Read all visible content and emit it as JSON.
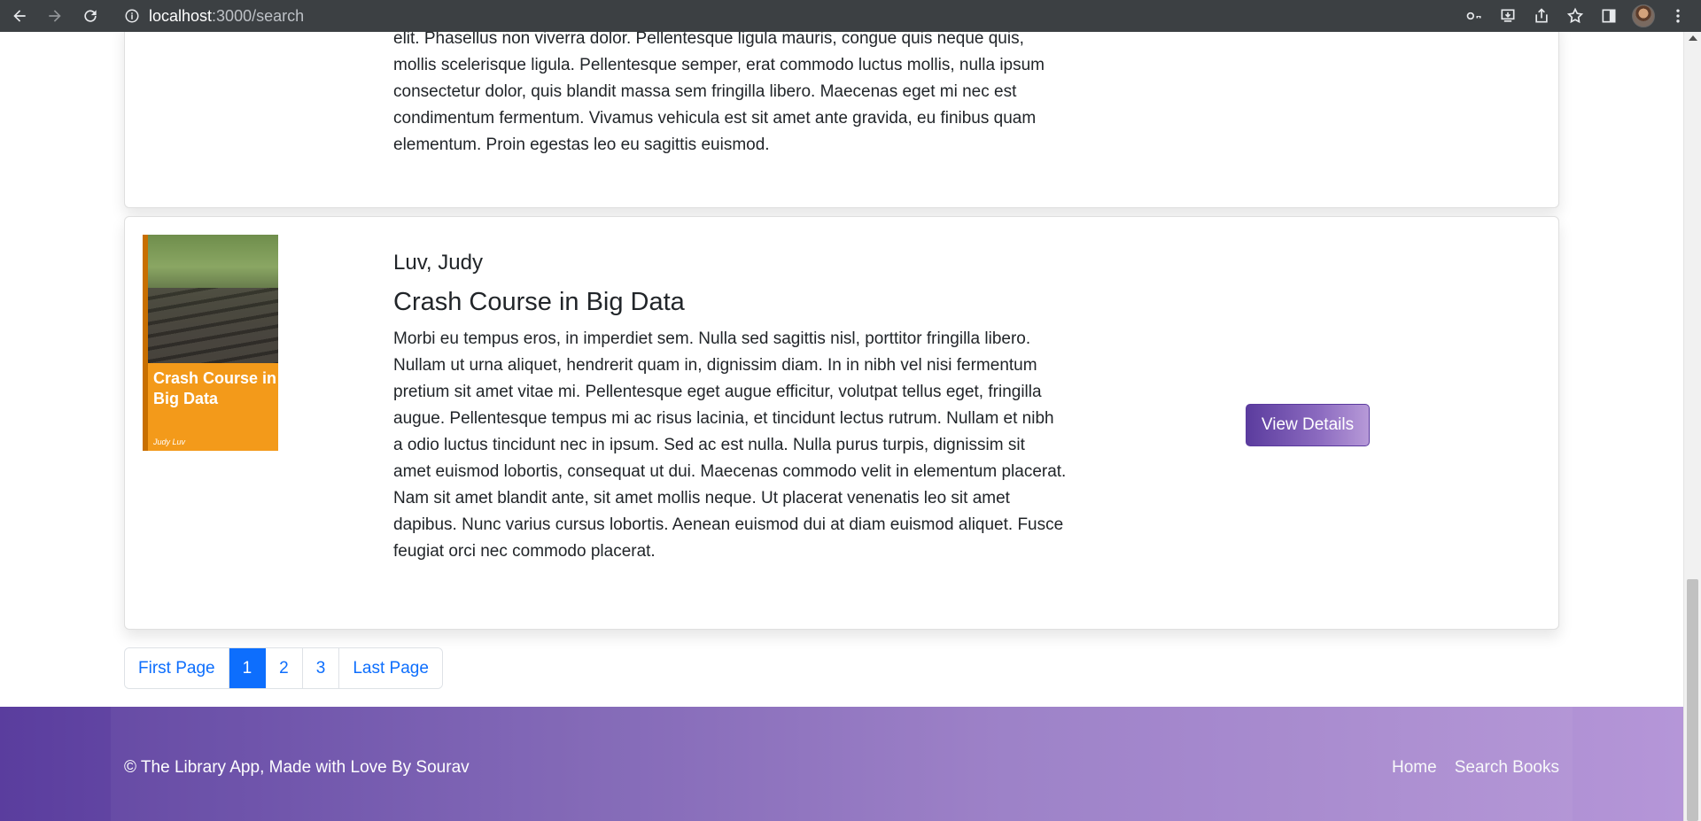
{
  "browser": {
    "url_host": "localhost",
    "url_path": ":3000/search"
  },
  "results": [
    {
      "description": "elit. Phasellus non viverra dolor. Pellentesque ligula mauris, congue quis neque quis, mollis scelerisque ligula. Pellentesque semper, erat commodo luctus mollis, nulla ipsum consectetur dolor, quis blandit massa sem fringilla libero. Maecenas eget mi nec est condimentum fermentum. Vivamus vehicula est sit amet ante gravida, eu finibus quam elementum. Proin egestas leo eu sagittis euismod."
    },
    {
      "author": "Luv, Judy",
      "title": "Crash Course in Big Data",
      "cover_title": "Crash Course in Big Data",
      "cover_author": "Judy Luv",
      "description": "Morbi eu tempus eros, in imperdiet sem. Nulla sed sagittis nisl, porttitor fringilla libero. Nullam ut urna aliquet, hendrerit quam in, dignissim diam. In in nibh vel nisi fermentum pretium sit amet vitae mi. Pellentesque eget augue efficitur, volutpat tellus eget, fringilla augue. Pellentesque tempus mi ac risus lacinia, et tincidunt lectus rutrum. Nullam et nibh a odio luctus tincidunt nec in ipsum. Sed ac est nulla. Nulla purus turpis, dignissim sit amet euismod lobortis, consequat ut dui. Maecenas commodo velit in elementum placerat. Nam sit amet blandit ante, sit amet mollis neque. Ut placerat venenatis leo sit amet dapibus. Nunc varius cursus lobortis. Aenean euismod dui at diam euismod aliquet. Fusce feugiat orci nec commodo placerat.",
      "button_label": "View Details"
    }
  ],
  "pagination": {
    "first": "First Page",
    "pages": [
      "1",
      "2",
      "3"
    ],
    "active": "1",
    "last": "Last Page"
  },
  "footer": {
    "copyright": "© The Library App, Made with Love By Sourav",
    "links": [
      "Home",
      "Search Books"
    ]
  },
  "colors": {
    "primary": "#0d6efd",
    "footer_start": "#5a3d9e",
    "footer_end": "#b596d8",
    "cover": "#f39a1a"
  }
}
